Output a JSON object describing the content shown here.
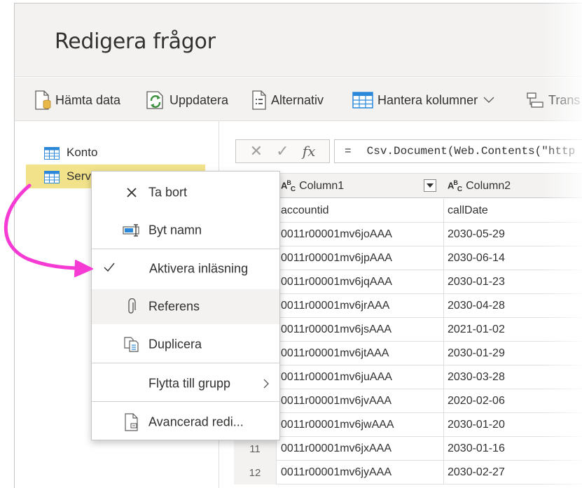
{
  "window": {
    "title": "Redigera frågor"
  },
  "toolbar": {
    "get_data": "Hämta data",
    "refresh": "Uppdatera",
    "options": "Alternativ",
    "manage_columns": "Hantera kolumner",
    "transform": "Trans"
  },
  "queries": [
    {
      "label": "Konto"
    },
    {
      "label": "ServiceCalls"
    }
  ],
  "formula_bar": {
    "equals": "=",
    "formula": "Csv.Document(Web.Contents(\"http"
  },
  "grid": {
    "columns": [
      {
        "label": "Column1"
      },
      {
        "label": "Column2"
      }
    ],
    "rows": [
      {
        "n": "",
        "c1": "accountid",
        "c2": "callDate"
      },
      {
        "n": "",
        "c1": "0011r00001mv6joAAA",
        "c2": "2030-05-29"
      },
      {
        "n": "",
        "c1": "0011r00001mv6jpAAA",
        "c2": "2030-06-14"
      },
      {
        "n": "",
        "c1": "0011r00001mv6jqAAA",
        "c2": "2030-01-23"
      },
      {
        "n": "",
        "c1": "0011r00001mv6jrAAA",
        "c2": "2030-04-28"
      },
      {
        "n": "",
        "c1": "0011r00001mv6jsAAA",
        "c2": "2021-01-02"
      },
      {
        "n": "",
        "c1": "0011r00001mv6jtAAA",
        "c2": "2030-01-29"
      },
      {
        "n": "",
        "c1": "0011r00001mv6juAAA",
        "c2": "2030-03-28"
      },
      {
        "n": "",
        "c1": "0011r00001mv6jvAAA",
        "c2": "2020-02-06"
      },
      {
        "n": "",
        "c1": "0011r00001mv6jwAAA",
        "c2": "2030-01-20"
      },
      {
        "n": "11",
        "c1": "0011r00001mv6jxAAA",
        "c2": "2030-01-16"
      },
      {
        "n": "12",
        "c1": "0011r00001mv6jyAAA",
        "c2": "2030-02-27"
      }
    ]
  },
  "context_menu": {
    "delete": "Ta bort",
    "rename": "Byt namn",
    "enable_load": "Aktivera inläsning",
    "reference": "Referens",
    "duplicate": "Duplicera",
    "move_to_group": "Flytta till grupp",
    "advanced_editor": "Avancerad redi..."
  },
  "colors": {
    "accent_arrow": "#f53bd4",
    "selection": "#f2e38a",
    "toolbar_bg": "#f3f2f1",
    "refresh_green": "#3a8f3a",
    "db_yellow": "#e8b84a",
    "table_blue": "#2b88d8"
  }
}
